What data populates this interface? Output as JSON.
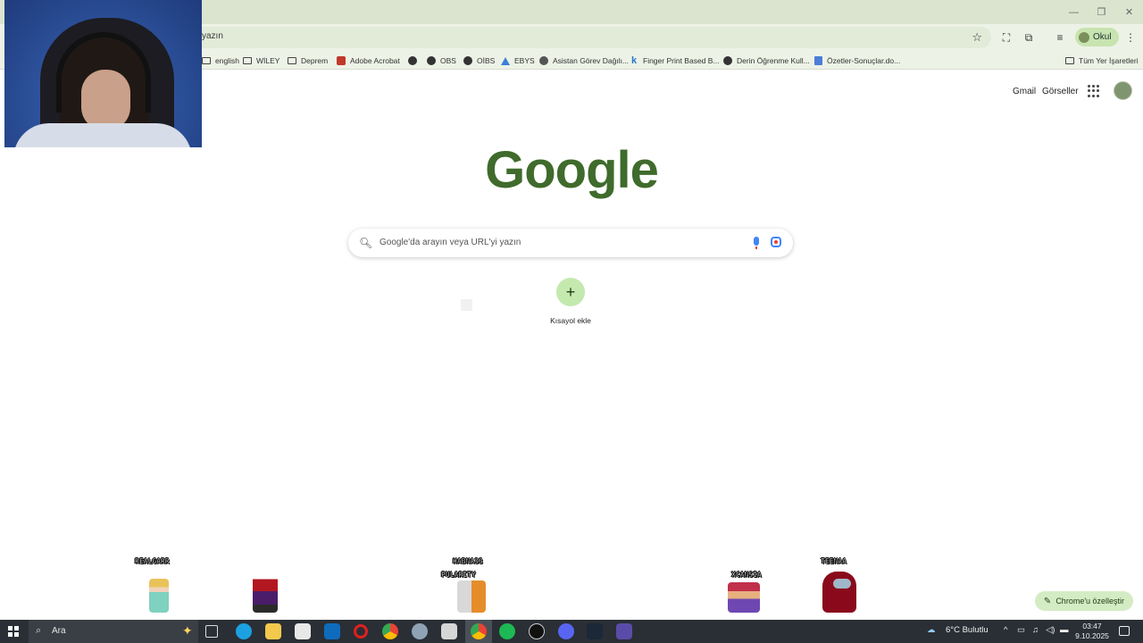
{
  "window": {
    "minimize_icon": "minimize-icon",
    "restore_icon": "restore-icon",
    "close_icon": "close-icon"
  },
  "toolbar": {
    "omnibox_text": "yazın",
    "profile_name": "Okul"
  },
  "bookmarks": [
    {
      "label": "english",
      "icon": "folder-icon"
    },
    {
      "label": "WİLEY",
      "icon": "folder-icon"
    },
    {
      "label": "Deprem",
      "icon": "folder-icon"
    },
    {
      "label": "Adobe Acrobat",
      "icon": "acrobat-icon"
    },
    {
      "label": "",
      "icon": "globe-icon"
    },
    {
      "label": "OBS",
      "icon": "globe-icon"
    },
    {
      "label": "OİBS",
      "icon": "globe-icon"
    },
    {
      "label": "EBYS",
      "icon": "triangle-icon"
    },
    {
      "label": "Asistan Görev Dağılı...",
      "icon": "gear-icon"
    },
    {
      "label": "Finger Print Based B...",
      "icon": "k-icon"
    },
    {
      "label": "Derin Öğrenme Kull...",
      "icon": "globe-icon"
    },
    {
      "label": "Özetler-Sonuçlar.do...",
      "icon": "doc-icon"
    }
  ],
  "all_bookmarks": "Tüm Yer İşaretleri",
  "header": {
    "gmail": "Gmail",
    "images": "Görseller"
  },
  "logo": "Google",
  "search": {
    "placeholder": "Google'da arayın veya URL'yi yazın"
  },
  "shortcut": {
    "label": "Kısayol ekle"
  },
  "sprites": [
    {
      "name": "REALGARR"
    },
    {
      "name": "HABNA33"
    },
    {
      "name": "PULARITY"
    },
    {
      "name": "XCANSIA"
    },
    {
      "name": "TEENAA"
    }
  ],
  "customize": {
    "label": "Chrome'u özelleştir"
  },
  "taskbar": {
    "search_label": "Ara",
    "weather": "6°C  Bulutlu",
    "time": "03:47",
    "date": "9.10.2025"
  }
}
